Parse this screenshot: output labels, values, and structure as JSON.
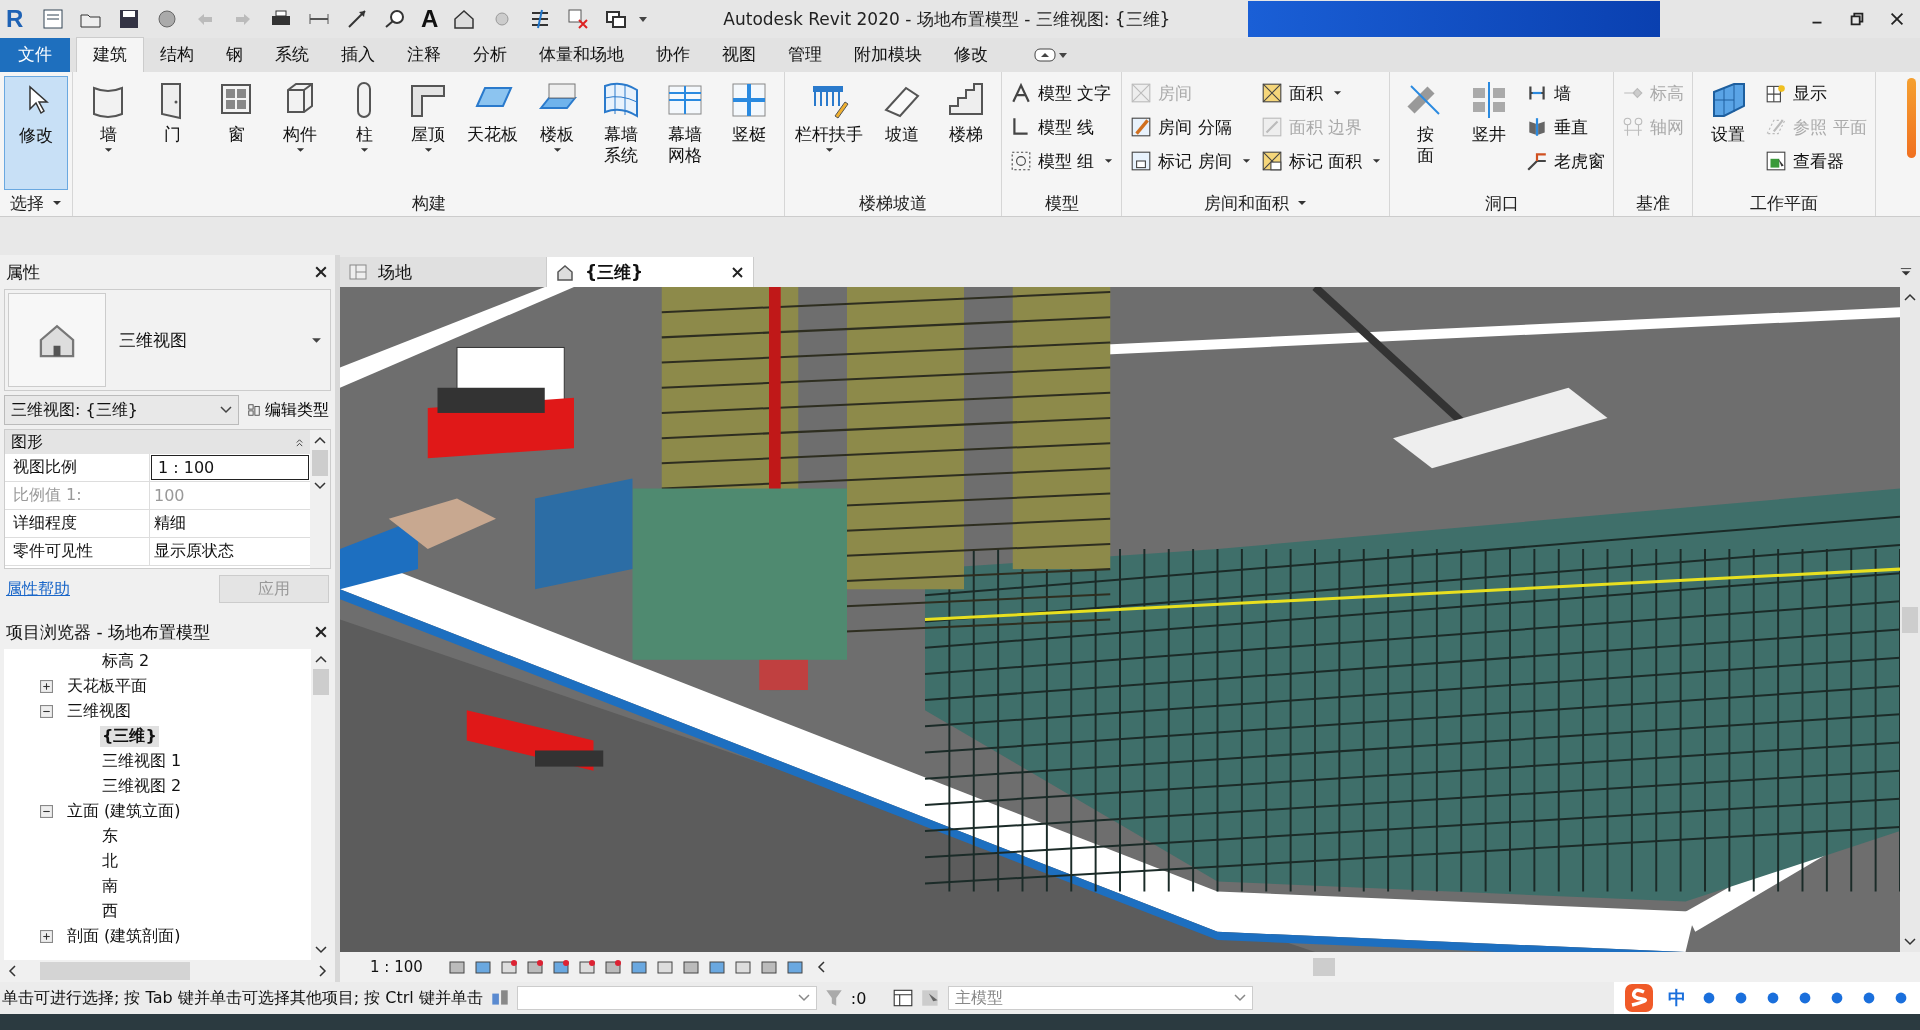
{
  "window": {
    "title": "Autodesk Revit 2020 - 场地布置模型 - 三维视图: {三维}",
    "logo": "R",
    "text_tool_glyph": "A"
  },
  "ribbon_tabs": [
    {
      "label": "文件",
      "kind": "file",
      "selected": false
    },
    {
      "label": "建筑",
      "kind": "tab",
      "selected": true
    },
    {
      "label": "结构",
      "kind": "tab",
      "selected": false
    },
    {
      "label": "钢",
      "kind": "tab",
      "selected": false
    },
    {
      "label": "系统",
      "kind": "tab",
      "selected": false
    },
    {
      "label": "插入",
      "kind": "tab",
      "selected": false
    },
    {
      "label": "注释",
      "kind": "tab",
      "selected": false
    },
    {
      "label": "分析",
      "kind": "tab",
      "selected": false
    },
    {
      "label": "体量和场地",
      "kind": "tab",
      "selected": false
    },
    {
      "label": "协作",
      "kind": "tab",
      "selected": false
    },
    {
      "label": "视图",
      "kind": "tab",
      "selected": false
    },
    {
      "label": "管理",
      "kind": "tab",
      "selected": false
    },
    {
      "label": "附加模块",
      "kind": "tab",
      "selected": false
    },
    {
      "label": "修改",
      "kind": "tab",
      "selected": false
    }
  ],
  "ribbon_panels": [
    {
      "label": "选择",
      "has_menu": true,
      "tools": [
        {
          "label": "修改",
          "kind": "large",
          "selected": true,
          "has_menu": false,
          "disabled": false
        }
      ]
    },
    {
      "label": "构建",
      "has_menu": false,
      "tools": [
        {
          "label": "墙",
          "kind": "large",
          "selected": false,
          "has_menu": true,
          "disabled": false
        },
        {
          "label": "门",
          "kind": "large",
          "selected": false,
          "has_menu": false,
          "disabled": false
        },
        {
          "label": "窗",
          "kind": "large",
          "selected": false,
          "has_menu": false,
          "disabled": false
        },
        {
          "label": "构件",
          "kind": "large",
          "selected": false,
          "has_menu": true,
          "disabled": false
        },
        {
          "label": "柱",
          "kind": "large",
          "selected": false,
          "has_menu": true,
          "disabled": false
        },
        {
          "label": "屋顶",
          "kind": "large",
          "selected": false,
          "has_menu": true,
          "disabled": false
        },
        {
          "label": "天花板",
          "kind": "large",
          "selected": false,
          "has_menu": false,
          "disabled": false
        },
        {
          "label": "楼板",
          "kind": "large",
          "selected": false,
          "has_menu": true,
          "disabled": false
        },
        {
          "label": "幕墙系统",
          "kind": "large",
          "wrap": true,
          "selected": false,
          "has_menu": false,
          "disabled": false
        },
        {
          "label": "幕墙网格",
          "kind": "large",
          "wrap": true,
          "selected": false,
          "has_menu": false,
          "disabled": false
        },
        {
          "label": "竖梃",
          "kind": "large",
          "selected": false,
          "has_menu": false,
          "disabled": false
        }
      ]
    },
    {
      "label": "楼梯坡道",
      "has_menu": false,
      "tools": [
        {
          "label": "栏杆扶手",
          "kind": "large",
          "selected": false,
          "has_menu": true,
          "disabled": false
        },
        {
          "label": "坡道",
          "kind": "large",
          "selected": false,
          "has_menu": false,
          "disabled": false
        },
        {
          "label": "楼梯",
          "kind": "large",
          "selected": false,
          "has_menu": false,
          "disabled": false
        }
      ]
    },
    {
      "label": "模型",
      "has_menu": false,
      "tools": [
        {
          "label": "模型 文字",
          "kind": "small",
          "selected": false,
          "has_menu": false,
          "disabled": false
        },
        {
          "label": "模型 线",
          "kind": "small",
          "selected": false,
          "has_menu": false,
          "disabled": false
        },
        {
          "label": "模型 组",
          "kind": "small",
          "selected": false,
          "has_menu": true,
          "disabled": false
        }
      ]
    },
    {
      "label": "房间和面积",
      "has_menu": true,
      "tools": [
        {
          "label": "房间",
          "kind": "small",
          "selected": false,
          "has_menu": false,
          "disabled": true
        },
        {
          "label": "房间 分隔",
          "kind": "small",
          "selected": false,
          "has_menu": false,
          "disabled": false
        },
        {
          "label": "标记 房间",
          "kind": "small",
          "selected": false,
          "has_menu": true,
          "disabled": false
        },
        {
          "label": "面积",
          "kind": "small",
          "selected": false,
          "has_menu": true,
          "disabled": false
        },
        {
          "label": "面积 边界",
          "kind": "small",
          "selected": false,
          "has_menu": false,
          "disabled": true
        },
        {
          "label": "标记 面积",
          "kind": "small",
          "selected": false,
          "has_menu": true,
          "disabled": false
        }
      ]
    },
    {
      "label": "洞口",
      "has_menu": false,
      "tools": [
        {
          "label": "按面",
          "kind": "large",
          "wrap": true,
          "selected": false,
          "has_menu": false,
          "disabled": false
        },
        {
          "label": "竖井",
          "kind": "large",
          "selected": false,
          "has_menu": false,
          "disabled": false
        },
        {
          "label": "墙",
          "kind": "small",
          "selected": false,
          "has_menu": false,
          "disabled": false
        },
        {
          "label": "垂直",
          "kind": "small",
          "selected": false,
          "has_menu": false,
          "disabled": false
        },
        {
          "label": "老虎窗",
          "kind": "small",
          "selected": false,
          "has_menu": false,
          "disabled": false
        }
      ]
    },
    {
      "label": "基准",
      "has_menu": false,
      "tools": [
        {
          "label": "标高",
          "kind": "small",
          "selected": false,
          "has_menu": false,
          "disabled": true
        },
        {
          "label": "轴网",
          "kind": "small",
          "selected": false,
          "has_menu": false,
          "disabled": true
        }
      ]
    },
    {
      "label": "工作平面",
      "has_menu": false,
      "tools": [
        {
          "label": "设置",
          "kind": "large",
          "selected": false,
          "has_menu": false,
          "disabled": false
        },
        {
          "label": "显示",
          "kind": "small",
          "selected": false,
          "has_menu": false,
          "disabled": false
        },
        {
          "label": "参照 平面",
          "kind": "small",
          "selected": false,
          "has_menu": false,
          "disabled": true
        },
        {
          "label": "查看器",
          "kind": "small",
          "selected": false,
          "has_menu": false,
          "disabled": false
        }
      ]
    }
  ],
  "properties": {
    "title": "属性",
    "type_name": "三维视图",
    "instance_selector": "三维视图: {三维}",
    "edit_type": "编辑类型",
    "group": "图形",
    "rows": [
      {
        "name": "视图比例",
        "value": "1 : 100",
        "kind": "input",
        "disabled": false
      },
      {
        "name": "比例值 1:",
        "value": "100",
        "kind": "text",
        "disabled": true
      },
      {
        "name": "详细程度",
        "value": "精细",
        "kind": "text",
        "disabled": false
      },
      {
        "name": "零件可见性",
        "value": "显示原状态",
        "kind": "text",
        "disabled": false
      }
    ],
    "help_link": "属性帮助",
    "apply": "应用"
  },
  "project_browser": {
    "title": "项目浏览器 - 场地布置模型",
    "items": [
      {
        "children": [
          {
            "label": "标高 2",
            "selected": false
          }
        ]
      },
      {
        "label": "天花板平面",
        "expanded": false,
        "selected": false
      },
      {
        "label": "三维视图",
        "expanded": true,
        "selected": false,
        "children": [
          {
            "label": "{三维}",
            "selected": true
          },
          {
            "label": "三维视图 1",
            "selected": false
          },
          {
            "label": "三维视图 2",
            "selected": false
          }
        ]
      },
      {
        "label": "立面 (建筑立面)",
        "expanded": true,
        "selected": false,
        "children": [
          {
            "label": "东",
            "selected": false
          },
          {
            "label": "北",
            "selected": false
          },
          {
            "label": "南",
            "selected": false
          },
          {
            "label": "西",
            "selected": false
          }
        ]
      },
      {
        "label": "剖面 (建筑剖面)",
        "expanded": false,
        "selected": false
      }
    ]
  },
  "view_tabs": [
    {
      "label": "场地",
      "selected": false
    },
    {
      "label": "{三维}",
      "selected": true
    }
  ],
  "view_control_bar": {
    "scale": "1 : 100"
  },
  "status_bar": {
    "message": "单击可进行选择; 按 Tab 键并单击可选择其他项目; 按 Ctrl 键并单击",
    "filter_count": ":0",
    "model": "主模型"
  },
  "ime": {
    "mode": "中"
  }
}
